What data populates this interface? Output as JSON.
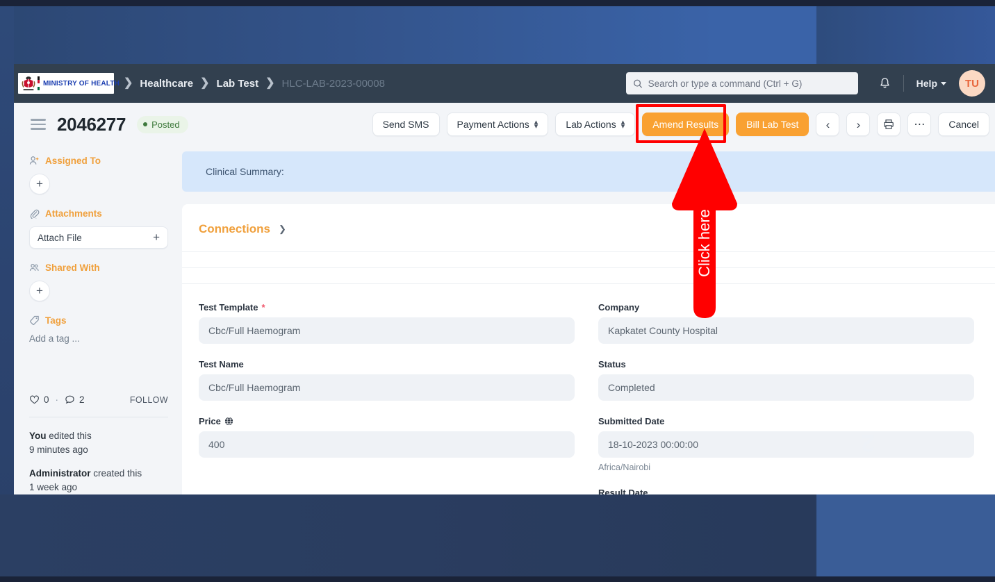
{
  "navbar": {
    "logo_text": "MINISTRY OF HEALTH",
    "breadcrumb": [
      {
        "label": "Healthcare",
        "muted": false
      },
      {
        "label": "Lab Test",
        "muted": false
      },
      {
        "label": "HLC-LAB-2023-00008",
        "muted": true
      }
    ],
    "search": {
      "placeholder": "Search or type a command (Ctrl + G)",
      "value": "",
      "icon": "search-icon"
    },
    "notifications_icon": "bell-icon",
    "help_label": "Help",
    "avatar_initials": "TU"
  },
  "page_header": {
    "menu_icon": "hamburger-icon",
    "title": "2046277",
    "status": "Posted",
    "status_color": "#3f7a3d",
    "toolbar": [
      {
        "label": "Send SMS",
        "style": "default",
        "has_stepper": false
      },
      {
        "label": "Payment Actions",
        "style": "default",
        "has_stepper": true
      },
      {
        "label": "Lab Actions",
        "style": "default",
        "has_stepper": true
      },
      {
        "label": "Amend Results",
        "style": "primary",
        "has_stepper": false
      },
      {
        "label": "Bill Lab Test",
        "style": "primary",
        "has_stepper": false
      }
    ],
    "prev_label": "‹",
    "next_label": "›",
    "print_icon": "printer-icon",
    "more_icon": "ellipsis-icon",
    "cancel_label": "Cancel",
    "primary_color": "#f9a132"
  },
  "sidebar": {
    "assigned_to": {
      "label": "Assigned To",
      "icon": "user-plus-icon",
      "add_label": "+"
    },
    "attachments": {
      "label": "Attachments",
      "icon": "paperclip-icon",
      "attach_label": "Attach File",
      "add_label": "+"
    },
    "shared_with": {
      "label": "Shared With",
      "icon": "users-icon",
      "add_label": "+"
    },
    "tags": {
      "label": "Tags",
      "icon": "tag-icon",
      "placeholder": "Add a tag ..."
    },
    "social": {
      "like_icon": "heart-icon",
      "like_count": "0",
      "separator": "·",
      "comment_icon": "comment-icon",
      "comment_count": "2",
      "follow_label": "FOLLOW"
    },
    "activity": [
      {
        "who": "You",
        "action": "edited this",
        "when": "9 minutes ago"
      },
      {
        "who": "Administrator",
        "action": "created this",
        "when": "1 week ago"
      }
    ]
  },
  "main": {
    "clinical_summary_label": "Clinical Summary:",
    "connections": {
      "title": "Connections",
      "chevron": "chevron-down-icon"
    },
    "fields_left": [
      {
        "label": "Test Template",
        "required": true,
        "value": "Cbc/Full Haemogram"
      },
      {
        "label": "Test Name",
        "required": false,
        "value": "Cbc/Full Haemogram"
      },
      {
        "label": "Price",
        "required": false,
        "value": "400",
        "icon": "globe-icon"
      }
    ],
    "fields_right": [
      {
        "label": "Company",
        "required": false,
        "value": "Kapkatet County Hospital"
      },
      {
        "label": "Status",
        "required": false,
        "value": "Completed"
      },
      {
        "label": "Submitted Date",
        "required": false,
        "value": "18-10-2023 00:00:00",
        "note": "Africa/Nairobi"
      },
      {
        "label": "Result Date",
        "required": false,
        "value": ""
      }
    ]
  },
  "annotation": {
    "text": "Click here",
    "color": "#ff0000",
    "target": "Amend Results"
  }
}
